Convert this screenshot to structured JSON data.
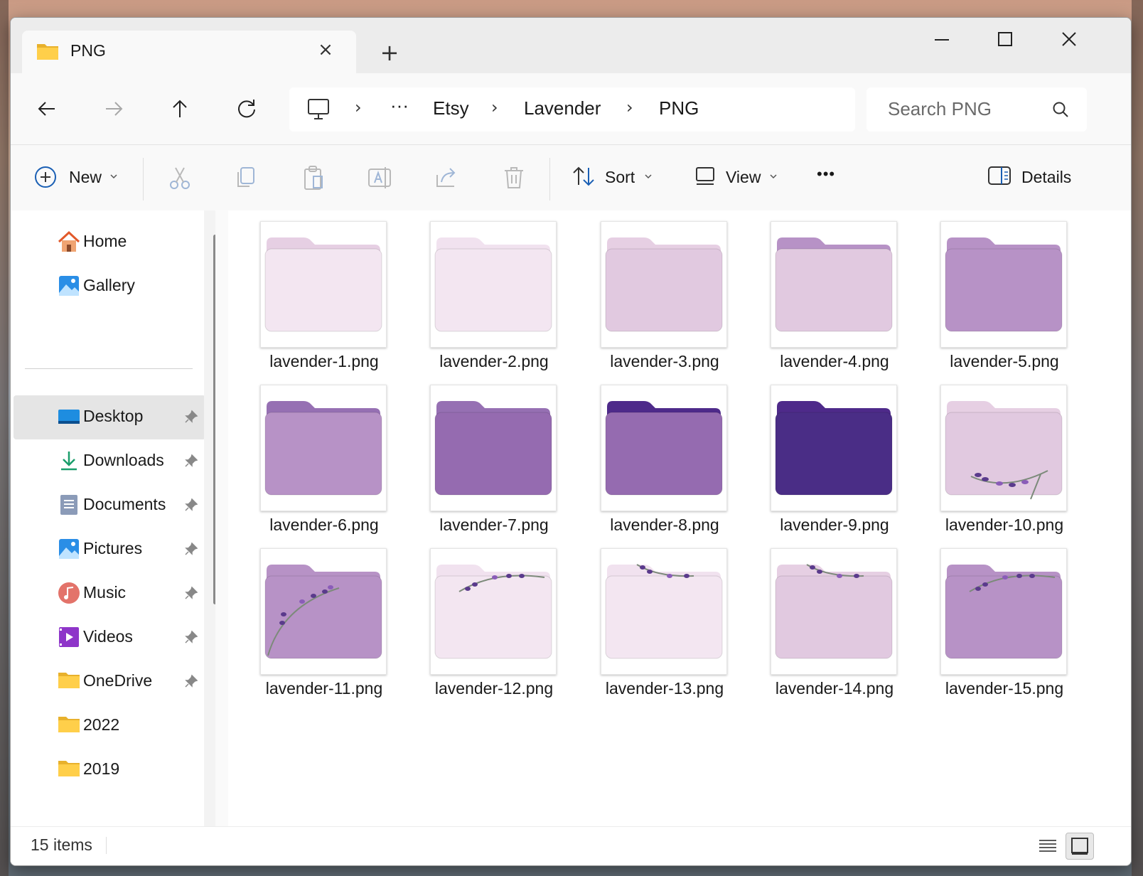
{
  "window": {
    "tab_title": "PNG",
    "tab_close": "×",
    "new_tab": "+",
    "minimize": "minimize",
    "maximize": "maximize",
    "close": "close"
  },
  "nav": {
    "back": "back",
    "forward": "forward",
    "up": "up",
    "refresh": "refresh"
  },
  "address": {
    "more": "···",
    "crumbs": [
      "Etsy",
      "Lavender",
      "PNG"
    ]
  },
  "search": {
    "placeholder": "Search PNG"
  },
  "toolbar": {
    "new_label": "New",
    "sort_label": "Sort",
    "view_label": "View",
    "more_label": "•••",
    "details_label": "Details"
  },
  "sidebar": {
    "top": [
      {
        "label": "Home",
        "icon": "home-icon"
      },
      {
        "label": "Gallery",
        "icon": "gallery-icon"
      }
    ],
    "quick": [
      {
        "label": "Desktop",
        "icon": "desktop-icon",
        "pinned": true,
        "selected": true
      },
      {
        "label": "Downloads",
        "icon": "downloads-icon",
        "pinned": true
      },
      {
        "label": "Documents",
        "icon": "documents-icon",
        "pinned": true
      },
      {
        "label": "Pictures",
        "icon": "pictures-icon",
        "pinned": true
      },
      {
        "label": "Music",
        "icon": "music-icon",
        "pinned": true
      },
      {
        "label": "Videos",
        "icon": "videos-icon",
        "pinned": true
      },
      {
        "label": "OneDrive",
        "icon": "folder-icon",
        "pinned": true
      },
      {
        "label": "2022",
        "icon": "folder-icon",
        "pinned": false
      },
      {
        "label": "2019",
        "icon": "folder-icon",
        "pinned": false
      }
    ]
  },
  "files": [
    {
      "name": "lavender-1.png",
      "back": "#e6cfe3",
      "front": "#f3e6f1",
      "sprig": "none"
    },
    {
      "name": "lavender-2.png",
      "back": "#f1e2ef",
      "front": "#f3e6f1",
      "sprig": "none"
    },
    {
      "name": "lavender-3.png",
      "back": "#e6cfe3",
      "front": "#e1c9e0",
      "sprig": "none"
    },
    {
      "name": "lavender-4.png",
      "back": "#b792c6",
      "front": "#e1c9e0",
      "sprig": "none"
    },
    {
      "name": "lavender-5.png",
      "back": "#b792c6",
      "front": "#b792c6",
      "sprig": "none"
    },
    {
      "name": "lavender-6.png",
      "back": "#9670b3",
      "front": "#b792c6",
      "sprig": "none"
    },
    {
      "name": "lavender-7.png",
      "back": "#9670b3",
      "front": "#956bb0",
      "sprig": "none"
    },
    {
      "name": "lavender-8.png",
      "back": "#4e2a8a",
      "front": "#956bb0",
      "sprig": "none"
    },
    {
      "name": "lavender-9.png",
      "back": "#4e2a8a",
      "front": "#4a2d86",
      "sprig": "none"
    },
    {
      "name": "lavender-10.png",
      "back": "#e6cfe3",
      "front": "#e1c9e0",
      "sprig": "bottom"
    },
    {
      "name": "lavender-11.png",
      "back": "#b792c6",
      "front": "#b792c6",
      "sprig": "top-left"
    },
    {
      "name": "lavender-12.png",
      "back": "#f1e2ef",
      "front": "#f3e6f1",
      "sprig": "top"
    },
    {
      "name": "lavender-13.png",
      "back": "#f1e2ef",
      "front": "#f3e6f1",
      "sprig": "top-small"
    },
    {
      "name": "lavender-14.png",
      "back": "#e6cfe3",
      "front": "#e1c9e0",
      "sprig": "top-small"
    },
    {
      "name": "lavender-15.png",
      "back": "#b792c6",
      "front": "#b792c6",
      "sprig": "top"
    }
  ],
  "status": {
    "count": "15 items"
  }
}
